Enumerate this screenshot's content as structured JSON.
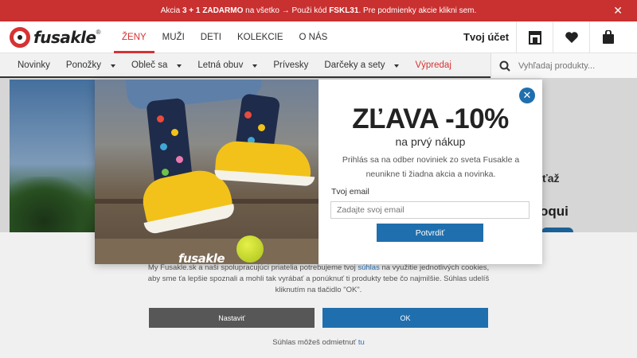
{
  "promo": {
    "text_before": "Akcia ",
    "highlight": "3 + 1 ZADARMO",
    "text_middle": " na všetko → Použi kód ",
    "code": "FSKL31",
    "text_after": ". Pre podmienky akcie klikni sem.",
    "close": "✕"
  },
  "header": {
    "logo_text": "fusakle",
    "logo_mark": "®",
    "nav": [
      "ŽENY",
      "MUŽI",
      "DETI",
      "KOLEKCIE",
      "O NÁS"
    ],
    "account": "Tvoj účet"
  },
  "categories": {
    "items": [
      "Novinky",
      "Ponožky",
      "Obleč sa",
      "Letná obuv",
      "Prívesky",
      "Darčeky a sety",
      "Výpredaj"
    ],
    "search_placeholder": "Vyhľadaj produkty..."
  },
  "background": {
    "partial_text_1": "ťaž",
    "partial_text_2": "oqui"
  },
  "modal": {
    "title": "ZĽAVA -10%",
    "subtitle": "na prvý nákup",
    "description": "Prihlás sa na odber noviniek zo sveta Fusakle a neunikne ti žiadna akcia a novinka.",
    "email_label": "Tvoj email",
    "email_placeholder": "Zadajte svoj email",
    "submit": "Potvrdiť",
    "photo_brand": "fusakle",
    "close": "✕"
  },
  "cookie": {
    "text_1": "My Fusakle.sk a naši spolupracujúci priatelia potrebujeme tvoj ",
    "link": "súhlas",
    "text_2": " na využitie jednotlivých cookies, aby sme ťa lepšie spoznali a mohli tak vyrábať a ponúknuť ti produkty tebe čo najmilšie. Súhlas udelíš kliknutím na tlačidlo \"OK\".",
    "settings_button": "Nastaviť",
    "ok_button": "OK",
    "decline_text": "Súhlas môžeš odmietnuť ",
    "decline_link": "tu"
  },
  "colors": {
    "brand_red": "#d63232",
    "promo_bg": "#c93030",
    "accent_blue": "#1f6fae"
  }
}
